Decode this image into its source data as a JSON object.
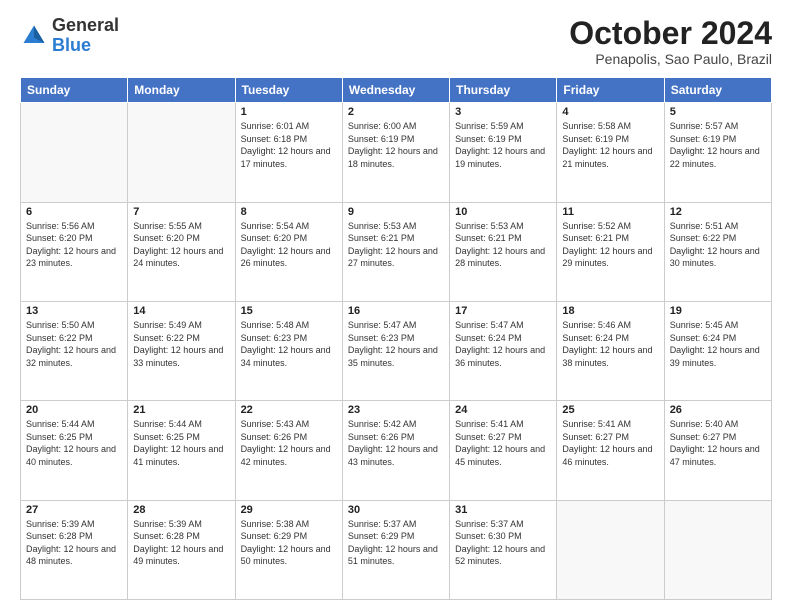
{
  "header": {
    "logo_general": "General",
    "logo_blue": "Blue",
    "month_title": "October 2024",
    "location": "Penapolis, Sao Paulo, Brazil"
  },
  "weekdays": [
    "Sunday",
    "Monday",
    "Tuesday",
    "Wednesday",
    "Thursday",
    "Friday",
    "Saturday"
  ],
  "weeks": [
    [
      {
        "day": "",
        "info": ""
      },
      {
        "day": "",
        "info": ""
      },
      {
        "day": "1",
        "info": "Sunrise: 6:01 AM\nSunset: 6:18 PM\nDaylight: 12 hours and 17 minutes."
      },
      {
        "day": "2",
        "info": "Sunrise: 6:00 AM\nSunset: 6:19 PM\nDaylight: 12 hours and 18 minutes."
      },
      {
        "day": "3",
        "info": "Sunrise: 5:59 AM\nSunset: 6:19 PM\nDaylight: 12 hours and 19 minutes."
      },
      {
        "day": "4",
        "info": "Sunrise: 5:58 AM\nSunset: 6:19 PM\nDaylight: 12 hours and 21 minutes."
      },
      {
        "day": "5",
        "info": "Sunrise: 5:57 AM\nSunset: 6:19 PM\nDaylight: 12 hours and 22 minutes."
      }
    ],
    [
      {
        "day": "6",
        "info": "Sunrise: 5:56 AM\nSunset: 6:20 PM\nDaylight: 12 hours and 23 minutes."
      },
      {
        "day": "7",
        "info": "Sunrise: 5:55 AM\nSunset: 6:20 PM\nDaylight: 12 hours and 24 minutes."
      },
      {
        "day": "8",
        "info": "Sunrise: 5:54 AM\nSunset: 6:20 PM\nDaylight: 12 hours and 26 minutes."
      },
      {
        "day": "9",
        "info": "Sunrise: 5:53 AM\nSunset: 6:21 PM\nDaylight: 12 hours and 27 minutes."
      },
      {
        "day": "10",
        "info": "Sunrise: 5:53 AM\nSunset: 6:21 PM\nDaylight: 12 hours and 28 minutes."
      },
      {
        "day": "11",
        "info": "Sunrise: 5:52 AM\nSunset: 6:21 PM\nDaylight: 12 hours and 29 minutes."
      },
      {
        "day": "12",
        "info": "Sunrise: 5:51 AM\nSunset: 6:22 PM\nDaylight: 12 hours and 30 minutes."
      }
    ],
    [
      {
        "day": "13",
        "info": "Sunrise: 5:50 AM\nSunset: 6:22 PM\nDaylight: 12 hours and 32 minutes."
      },
      {
        "day": "14",
        "info": "Sunrise: 5:49 AM\nSunset: 6:22 PM\nDaylight: 12 hours and 33 minutes."
      },
      {
        "day": "15",
        "info": "Sunrise: 5:48 AM\nSunset: 6:23 PM\nDaylight: 12 hours and 34 minutes."
      },
      {
        "day": "16",
        "info": "Sunrise: 5:47 AM\nSunset: 6:23 PM\nDaylight: 12 hours and 35 minutes."
      },
      {
        "day": "17",
        "info": "Sunrise: 5:47 AM\nSunset: 6:24 PM\nDaylight: 12 hours and 36 minutes."
      },
      {
        "day": "18",
        "info": "Sunrise: 5:46 AM\nSunset: 6:24 PM\nDaylight: 12 hours and 38 minutes."
      },
      {
        "day": "19",
        "info": "Sunrise: 5:45 AM\nSunset: 6:24 PM\nDaylight: 12 hours and 39 minutes."
      }
    ],
    [
      {
        "day": "20",
        "info": "Sunrise: 5:44 AM\nSunset: 6:25 PM\nDaylight: 12 hours and 40 minutes."
      },
      {
        "day": "21",
        "info": "Sunrise: 5:44 AM\nSunset: 6:25 PM\nDaylight: 12 hours and 41 minutes."
      },
      {
        "day": "22",
        "info": "Sunrise: 5:43 AM\nSunset: 6:26 PM\nDaylight: 12 hours and 42 minutes."
      },
      {
        "day": "23",
        "info": "Sunrise: 5:42 AM\nSunset: 6:26 PM\nDaylight: 12 hours and 43 minutes."
      },
      {
        "day": "24",
        "info": "Sunrise: 5:41 AM\nSunset: 6:27 PM\nDaylight: 12 hours and 45 minutes."
      },
      {
        "day": "25",
        "info": "Sunrise: 5:41 AM\nSunset: 6:27 PM\nDaylight: 12 hours and 46 minutes."
      },
      {
        "day": "26",
        "info": "Sunrise: 5:40 AM\nSunset: 6:27 PM\nDaylight: 12 hours and 47 minutes."
      }
    ],
    [
      {
        "day": "27",
        "info": "Sunrise: 5:39 AM\nSunset: 6:28 PM\nDaylight: 12 hours and 48 minutes."
      },
      {
        "day": "28",
        "info": "Sunrise: 5:39 AM\nSunset: 6:28 PM\nDaylight: 12 hours and 49 minutes."
      },
      {
        "day": "29",
        "info": "Sunrise: 5:38 AM\nSunset: 6:29 PM\nDaylight: 12 hours and 50 minutes."
      },
      {
        "day": "30",
        "info": "Sunrise: 5:37 AM\nSunset: 6:29 PM\nDaylight: 12 hours and 51 minutes."
      },
      {
        "day": "31",
        "info": "Sunrise: 5:37 AM\nSunset: 6:30 PM\nDaylight: 12 hours and 52 minutes."
      },
      {
        "day": "",
        "info": ""
      },
      {
        "day": "",
        "info": ""
      }
    ]
  ]
}
